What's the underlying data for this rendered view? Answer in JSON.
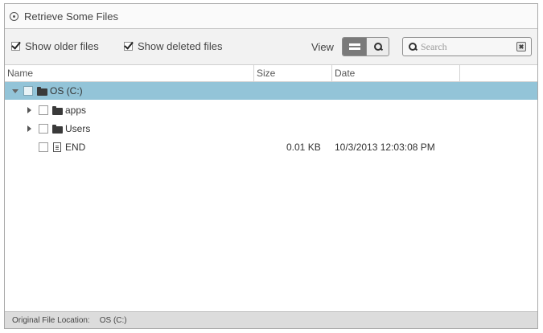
{
  "window": {
    "title": "Retrieve Some Files"
  },
  "toolbar": {
    "show_older_label": "Show older files",
    "show_older_checked": true,
    "show_deleted_label": "Show deleted files",
    "show_deleted_checked": true,
    "view_label": "View",
    "search_placeholder": "Search"
  },
  "columns": {
    "name": "Name",
    "size": "Size",
    "date": "Date"
  },
  "tree": [
    {
      "name": "OS (C:)",
      "type": "folder",
      "state": "expanded",
      "selected": true,
      "size": "",
      "date": ""
    },
    {
      "name": "apps",
      "type": "folder",
      "state": "collapsed",
      "selected": false,
      "size": "",
      "date": ""
    },
    {
      "name": "Users",
      "type": "folder",
      "state": "collapsed",
      "selected": false,
      "size": "",
      "date": ""
    },
    {
      "name": "END",
      "type": "file",
      "state": "none",
      "selected": false,
      "size": "0.01 KB",
      "date": "10/3/2013 12:03:08 PM"
    }
  ],
  "status": {
    "label": "Original File Location:",
    "value": "OS (C:)"
  },
  "colors": {
    "selection": "#93c4d8",
    "toolbar_bg": "#f2f2f2",
    "status_bg": "#dcdcdc"
  },
  "icons": {
    "title": "radio-circle-icon",
    "view_list": "list-view-icon",
    "view_search": "magnifier-icon",
    "search": "magnifier-icon",
    "clear": "close-box-icon",
    "folder": "folder-icon",
    "file": "document-icon",
    "expanded": "triangle-down-icon",
    "collapsed": "triangle-right-icon"
  }
}
